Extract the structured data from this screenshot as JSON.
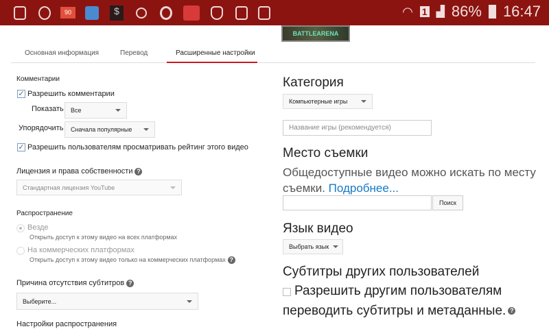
{
  "status_bar": {
    "notif_badge": "90",
    "sim": "1",
    "battery": "86%",
    "time": "16:47"
  },
  "thumbnail": {
    "text": "BATTLEARENA"
  },
  "tabs": [
    {
      "label": "Основная информация"
    },
    {
      "label": "Перевод"
    },
    {
      "label": "Расширенные настройки"
    }
  ],
  "left": {
    "comments": {
      "heading": "Комментарии",
      "allow": "Разрешить комментарии",
      "show_label": "Показать",
      "show_value": "Все",
      "sort_label": "Упорядочить",
      "sort_value": "Сначала популярные",
      "ratings": "Разрешить пользователям просматривать рейтинг этого видео"
    },
    "license": {
      "heading": "Лицензия и права собственности",
      "value": "Стандартная лицензия YouTube"
    },
    "distribution": {
      "heading": "Распространение",
      "everywhere": "Везде",
      "everywhere_desc": "Открыть доступ к этому видео на всех платформах",
      "commercial": "На коммерческих платформах",
      "commercial_desc": "Открыть доступ к этому видео только на коммерческих платформах"
    },
    "captions": {
      "heading": "Причина отсутствия субтитров",
      "value": "Выберите..."
    },
    "dist_settings": {
      "heading": "Настройки распространения"
    }
  },
  "right": {
    "category": {
      "heading": "Категория",
      "value": "Компьютерные игры",
      "game_placeholder": "Название игры (рекомендуется)"
    },
    "location": {
      "heading": "Место съемки",
      "desc": "Общедоступные видео можно искать по месту съемки.",
      "link": "Подробнее...",
      "search_button": "Поиск"
    },
    "language": {
      "heading": "Язык видео",
      "button": "Выбрать язык"
    },
    "community": {
      "heading": "Субтитры других пользователей",
      "line1": "Разрешить другим пользователям",
      "line2": "переводить субтитры и метаданные."
    }
  }
}
